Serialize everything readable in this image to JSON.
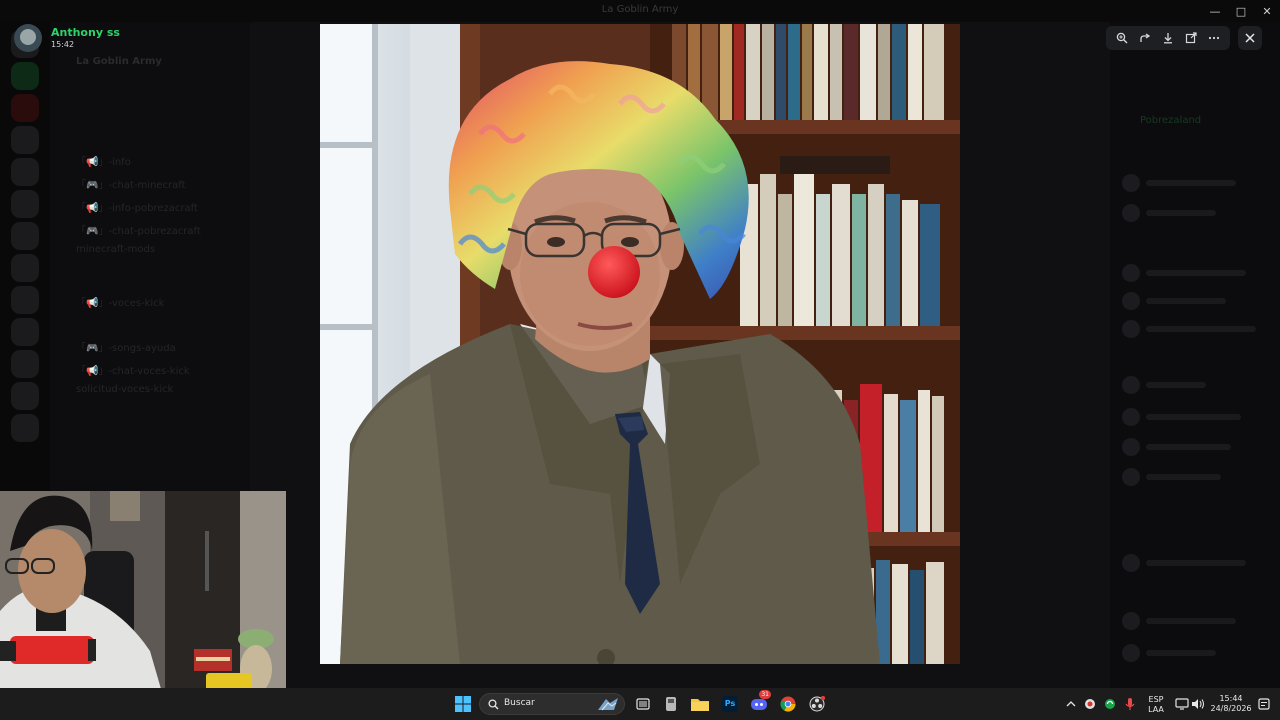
{
  "window": {
    "title": "La Goblin Army"
  },
  "viewer": {
    "user_name": "Anthony ss",
    "timestamp": "15:42",
    "tools": [
      "zoom-icon",
      "forward-icon",
      "download-icon",
      "open-external-icon",
      "more-icon"
    ],
    "close_icon": "close-icon"
  },
  "background_discord": {
    "server_name": "La Goblin Army",
    "channels": [
      "「📢」-info",
      "「🎮」-chat-minecraft",
      "「📢」-info-pobrezacraft",
      "「🎮」-chat-pobrezacraft",
      "minecraft-mods",
      "「📢」-voces-kick",
      "「🎮」-songs-ayuda",
      "「📢」-chat-voces-kick",
      "solicitud-voces-kick"
    ],
    "member_heading": "Pobrezaland"
  },
  "taskbar": {
    "search_placeholder": "Buscar",
    "apps": [
      "windows-start-icon",
      "search-icon",
      "task-view-icon",
      "file-explorer-icon",
      "photoshop-icon",
      "discord-icon",
      "chrome-icon",
      "obs-icon"
    ],
    "photoshop_label": "Ps",
    "language_top": "ESP",
    "language_bottom": "LAA",
    "clock_time": "15:44",
    "clock_date": "24/8/2026",
    "discord_badge": "31"
  },
  "colors": {
    "accent_green": "#2fd36b",
    "taskbar_bg": "#1c1c1c"
  }
}
